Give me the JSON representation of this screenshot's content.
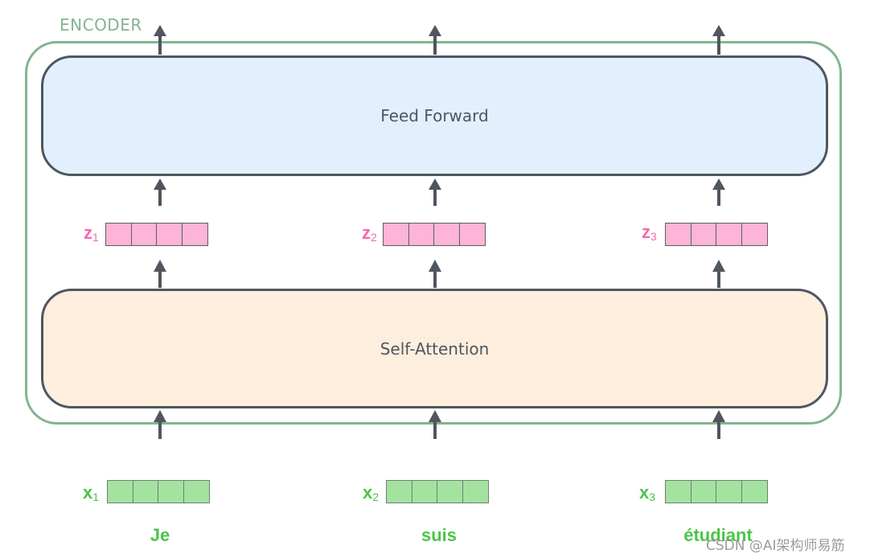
{
  "encoder": {
    "label": "ENCODER"
  },
  "layers": {
    "feed_forward": "Feed Forward",
    "self_attention": "Self-Attention"
  },
  "outputs_z": [
    {
      "symbol": "z",
      "index": "1",
      "cells": 4
    },
    {
      "symbol": "z",
      "index": "2",
      "cells": 4
    },
    {
      "symbol": "z",
      "index": "3",
      "cells": 4
    }
  ],
  "inputs_x": [
    {
      "symbol": "x",
      "index": "1",
      "cells": 4,
      "word": "Je"
    },
    {
      "symbol": "x",
      "index": "2",
      "cells": 4,
      "word": "suis"
    },
    {
      "symbol": "x",
      "index": "3",
      "cells": 4,
      "word": "étudiant"
    }
  ],
  "colors": {
    "encoder_border": "#82b590",
    "layer_border": "#50565f",
    "feed_forward_fill": "#e2f0fd",
    "self_attention_fill": "#feeede",
    "z_vector_fill": "#fdb4d7",
    "z_label": "#f468ac",
    "x_vector_fill": "#a3e39f",
    "x_label": "#4cc44a"
  },
  "watermark": "CSDN @AI架构师易筋"
}
